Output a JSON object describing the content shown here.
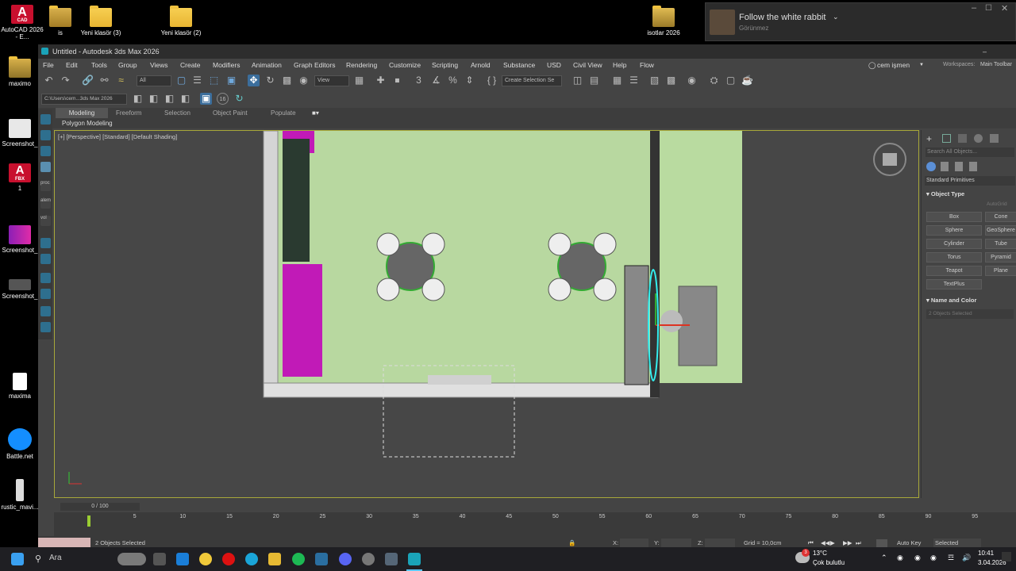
{
  "desktop": {
    "icons": [
      {
        "label": "AutoCAD 2026 - E...",
        "icon": "autocad-icon"
      },
      {
        "label": "is",
        "icon": "folder-dark-icon"
      },
      {
        "label": "Yeni klasör (3)",
        "icon": "folder-icon"
      },
      {
        "label": "Yeni klasör (2)",
        "icon": "folder-icon"
      },
      {
        "label": "isotlar 2026",
        "icon": "folder-dark-icon"
      },
      {
        "label": "maximo",
        "icon": "folder-dark-icon"
      },
      {
        "label": "Screenshot_",
        "icon": "image-icon"
      },
      {
        "label": "1",
        "icon": "autodesk-fbx-icon"
      },
      {
        "label": "Screenshot_",
        "icon": "image-icon"
      },
      {
        "label": "Screenshot_",
        "icon": "image-icon"
      },
      {
        "label": "maxima",
        "icon": "file-icon"
      },
      {
        "label": "Battle.net",
        "icon": "battlenet-icon"
      },
      {
        "label": "rustic_mavi...",
        "icon": "image-icon"
      }
    ],
    "fbx_badge": "FBX",
    "cad_badge": "CAD"
  },
  "notification": {
    "title": "Follow the white rabbit",
    "subtitle": "Görünmez"
  },
  "window": {
    "title": "Untitled - Autodesk 3ds Max 2026",
    "menus": [
      "File",
      "Edit",
      "Tools",
      "Group",
      "Views",
      "Create",
      "Modifiers",
      "Animation",
      "Graph Editors",
      "Rendering",
      "Customize",
      "Scripting",
      "Arnold",
      "Substance",
      "USD",
      "Civil View",
      "Help",
      "Flow"
    ],
    "user": "cem işmen",
    "workspaces_label": "Workspaces:",
    "workspace": "Main Toolbar",
    "selection_filter": "All",
    "ref_coord": "View",
    "selection_set": "Create Selection Se",
    "path": "C:\\Users\\cem...3ds Max 2026",
    "snap_value": "16",
    "ribbon_tabs": [
      "Modeling",
      "Freeform",
      "Selection",
      "Object Paint",
      "Populate"
    ],
    "ribbon_sub": "Polygon Modeling",
    "viewport_label": "[+] [Perspective] [Standard] [Default Shading]",
    "command_panel": {
      "search_placeholder": "Search All Objects...",
      "category": "Standard Primitives",
      "object_type_header": "Object Type",
      "autogrid": "AutoGrid",
      "buttons": [
        "Box",
        "Cone",
        "Sphere",
        "GeoSphere",
        "Cylinder",
        "Tube",
        "Torus",
        "Pyramid",
        "Teapot",
        "Plane",
        "TextPlus"
      ],
      "name_color_header": "Name and Color",
      "name_value": "2 Objects Selected"
    },
    "timeline": {
      "frame": "0 / 100",
      "ticks": [
        "5",
        "10",
        "15",
        "20",
        "25",
        "30",
        "35",
        "40",
        "45",
        "50",
        "55",
        "60",
        "65",
        "70",
        "75",
        "80",
        "85",
        "90",
        "95"
      ]
    },
    "status": {
      "selection": "2 Objects Selected",
      "x_label": "X:",
      "y_label": "Y:",
      "z_label": "Z:",
      "grid": "Grid = 10,0cm",
      "auto_key": "Auto Key",
      "key_mode": "Selected"
    }
  },
  "taskbar": {
    "search_placeholder": "Ara",
    "weather_temp": "13°C",
    "weather_desc": "Çok bulutlu",
    "weather_badge": "3",
    "time": "10:41",
    "date": "3.04.2026"
  }
}
